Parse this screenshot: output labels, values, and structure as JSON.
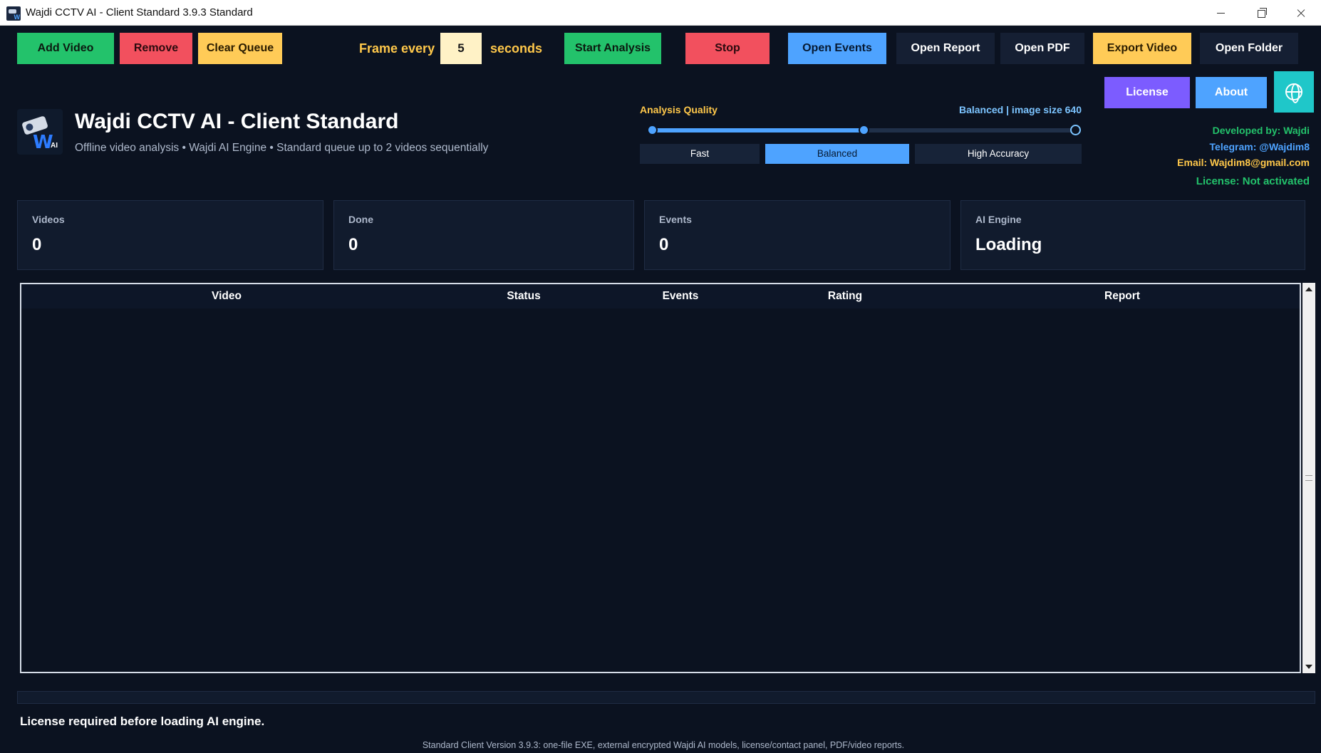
{
  "window": {
    "title": "Wajdi CCTV AI - Client Standard 3.9.3 Standard"
  },
  "toolbar": {
    "add_video": "Add Video",
    "remove": "Remove",
    "clear_queue": "Clear Queue",
    "frame_every_label": "Frame every",
    "frame_every_value": "5",
    "seconds_label": "seconds",
    "start_analysis": "Start Analysis",
    "stop": "Stop",
    "open_events": "Open Events",
    "open_report": "Open Report",
    "open_pdf": "Open PDF",
    "export_video": "Export Video",
    "open_folder": "Open Folder"
  },
  "header": {
    "title": "Wajdi CCTV AI - Client Standard",
    "subtitle": "Offline video analysis • Wajdi AI Engine • Standard queue up to 2 videos sequentially"
  },
  "quality": {
    "label": "Analysis Quality",
    "value_text": "Balanced | image size 640",
    "level": 0.5,
    "options": [
      "Fast",
      "Balanced",
      "High Accuracy"
    ],
    "selected": "Balanced"
  },
  "right_panel": {
    "license_button": "License",
    "about_button": "About",
    "language_icon": "globe-icon",
    "developed_by": "Developed by: Wajdi",
    "telegram": "Telegram: @Wajdim8",
    "email": "Email: Wajdim8@gmail.com",
    "license_status": "License: Not activated"
  },
  "stats": [
    {
      "label": "Videos",
      "value": "0"
    },
    {
      "label": "Done",
      "value": "0"
    },
    {
      "label": "Events",
      "value": "0"
    },
    {
      "label": "AI Engine",
      "value": "Loading"
    }
  ],
  "table": {
    "columns": [
      "Video",
      "Status",
      "Events",
      "Rating",
      "Report"
    ],
    "rows": []
  },
  "progress": {
    "value": 0
  },
  "status_message": "License required before loading AI engine.",
  "footer": "Standard Client Version 3.9.3: one-file EXE, external encrypted Wajdi AI models, license/contact panel, PDF/video reports.",
  "colors": {
    "background": "#0b1220",
    "green": "#23c26b",
    "red": "#f2505e",
    "yellow": "#ffcb57",
    "blue": "#4ea3ff",
    "purple": "#7c5cff",
    "teal": "#1fc7c9"
  }
}
